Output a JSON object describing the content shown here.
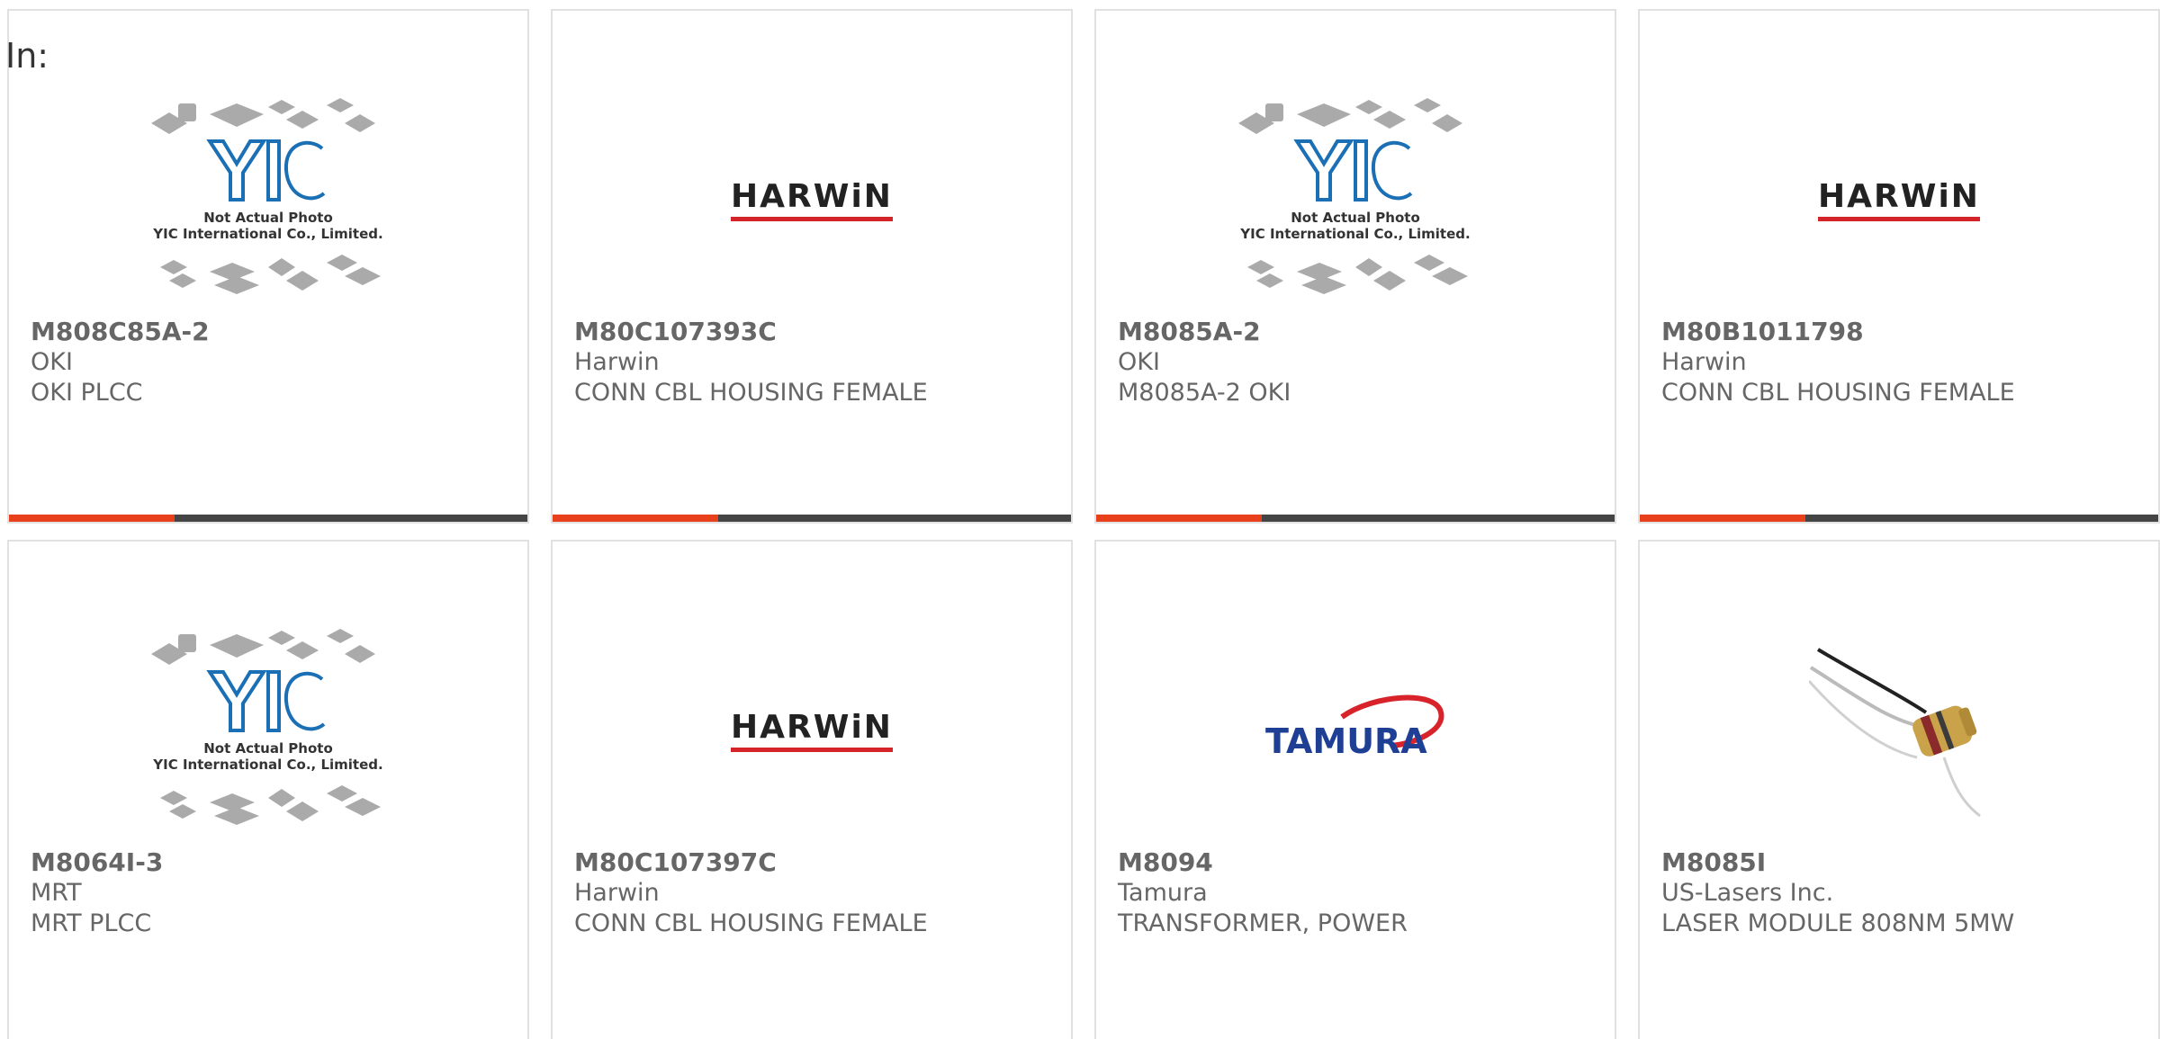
{
  "header": {
    "filter_label": "In:"
  },
  "colors": {
    "accent": "#e8401c",
    "track": "#444444",
    "text": "#666666",
    "border": "#e1e1e1"
  },
  "placeholder_logo": {
    "brand": "YIC",
    "line1": "Not Actual Photo",
    "line2": "YIC International Co., Limited."
  },
  "products": [
    {
      "part_number": "M808C85A-2",
      "brand": "OKI",
      "description": "OKI PLCC",
      "image": "yic-placeholder",
      "progress": 0.32
    },
    {
      "part_number": "M80C107393C",
      "brand": "Harwin",
      "description": "CONN CBL HOUSING FEMALE",
      "image": "harwin-logo",
      "logo_text": "HARWiN",
      "progress": 0.32
    },
    {
      "part_number": "M8085A-2",
      "brand": "OKI",
      "description": "M8085A-2 OKI",
      "image": "yic-placeholder",
      "progress": 0.32
    },
    {
      "part_number": "M80B1011798",
      "brand": "Harwin",
      "description": "CONN CBL HOUSING FEMALE",
      "image": "harwin-logo",
      "logo_text": "HARWiN",
      "progress": 0.32
    },
    {
      "part_number": "M8064I-3",
      "brand": "MRT",
      "description": "MRT PLCC",
      "image": "yic-placeholder"
    },
    {
      "part_number": "M80C107397C",
      "brand": "Harwin",
      "description": "CONN CBL HOUSING FEMALE",
      "image": "harwin-logo",
      "logo_text": "HARWiN"
    },
    {
      "part_number": "M8094",
      "brand": "Tamura",
      "description": "TRANSFORMER, POWER",
      "image": "tamura-logo",
      "logo_text": "TAMURA"
    },
    {
      "part_number": "M8085I",
      "brand": "US-Lasers Inc.",
      "description": "LASER MODULE 808NM 5MW",
      "image": "laser-module-photo"
    }
  ]
}
